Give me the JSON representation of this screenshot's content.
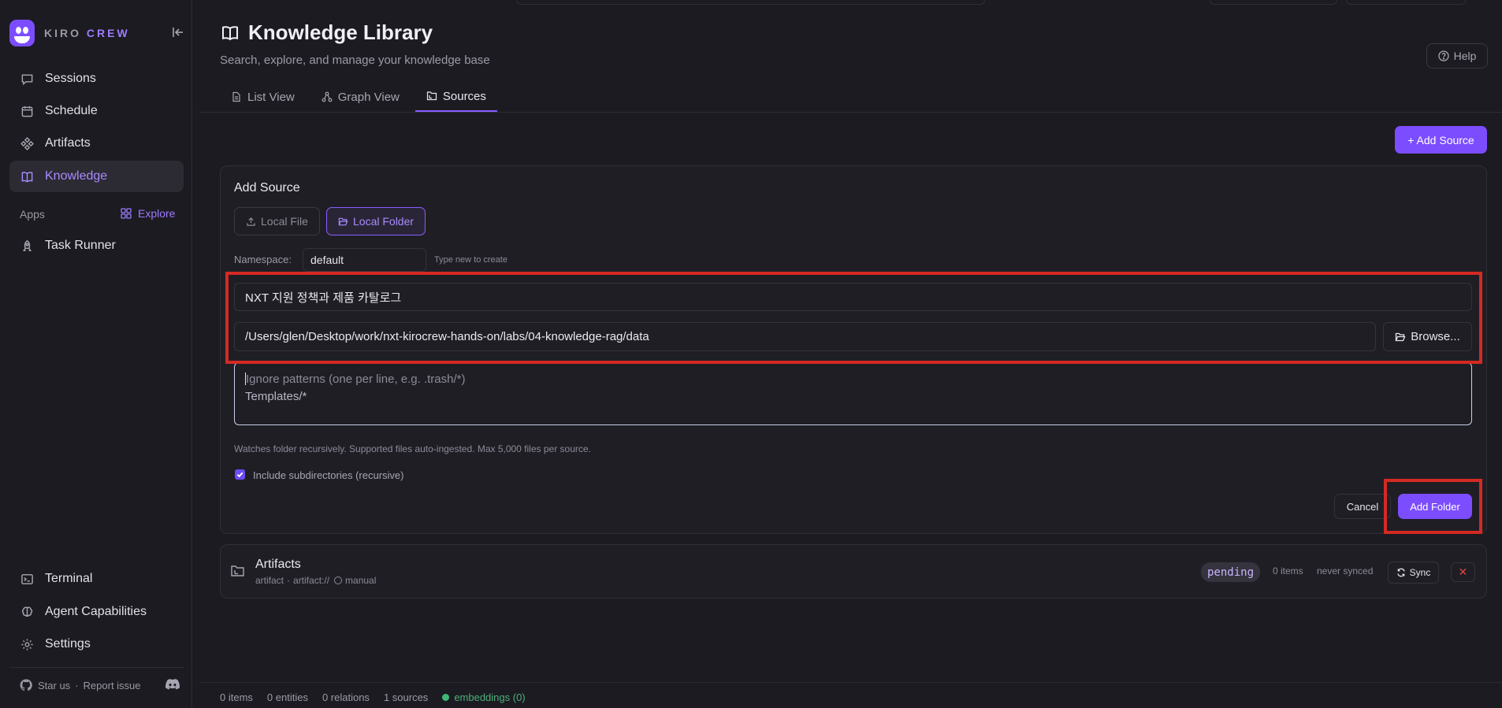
{
  "brand": {
    "word1": "KIRO",
    "word2": "CREW"
  },
  "sidebar": {
    "items": [
      {
        "label": "Sessions",
        "icon": "chat-icon"
      },
      {
        "label": "Schedule",
        "icon": "calendar-icon"
      },
      {
        "label": "Artifacts",
        "icon": "artifacts-icon"
      },
      {
        "label": "Knowledge",
        "icon": "book-icon",
        "active": true
      }
    ],
    "apps_label": "Apps",
    "explore_label": "Explore",
    "apps": [
      {
        "label": "Task Runner",
        "icon": "rocket-icon"
      }
    ],
    "bottom_items": [
      {
        "label": "Terminal",
        "icon": "terminal-icon"
      },
      {
        "label": "Agent Capabilities",
        "icon": "brain-icon"
      },
      {
        "label": "Settings",
        "icon": "gear-icon"
      }
    ],
    "footer": {
      "star": "Star us",
      "sep": "·",
      "report": "Report issue"
    }
  },
  "header": {
    "title": "Knowledge Library",
    "subtitle": "Search, explore, and manage your knowledge base",
    "help": "Help",
    "tabs": [
      {
        "label": "List View",
        "icon": "document-icon"
      },
      {
        "label": "Graph View",
        "icon": "graph-icon"
      },
      {
        "label": "Sources",
        "icon": "folder-tree-icon",
        "active": true
      }
    ]
  },
  "add_source_button": "+ Add Source",
  "form": {
    "title": "Add Source",
    "type_options": [
      "Local File",
      "Local Folder"
    ],
    "selected_type": "Local Folder",
    "namespace_label": "Namespace:",
    "namespace_value": "default",
    "namespace_hint": "Type new to create",
    "name_value": "NXT 지원 정책과 제품 카탈로그",
    "path_value": "/Users/glen/Desktop/work/nxt-kirocrew-hands-on/labs/04-knowledge-rag/data",
    "browse_label": "Browse...",
    "ignore_placeholder": "Ignore patterns (one per line, e.g. .trash/*)",
    "ignore_value": "Templates/*",
    "note": "Watches folder recursively. Supported files auto-ingested. Max 5,000 files per source.",
    "include_subdirs_label": "Include subdirectories (recursive)",
    "include_subdirs_checked": true,
    "cancel_label": "Cancel",
    "submit_label": "Add Folder"
  },
  "sources": [
    {
      "name": "Artifacts",
      "type": "artifact",
      "uri": "artifact://",
      "mode": "manual",
      "status": "pending",
      "items": "0 items",
      "synced": "never synced",
      "sync_label": "Sync",
      "delete_label": "✕"
    }
  ],
  "statusbar": {
    "items": "0 items",
    "entities": "0 entities",
    "relations": "0 relations",
    "sources": "1 sources",
    "embeddings": "embeddings (0)"
  },
  "colors": {
    "accent": "#7c4dff",
    "highlight": "#d42a23",
    "status_ok": "#3fb772"
  }
}
